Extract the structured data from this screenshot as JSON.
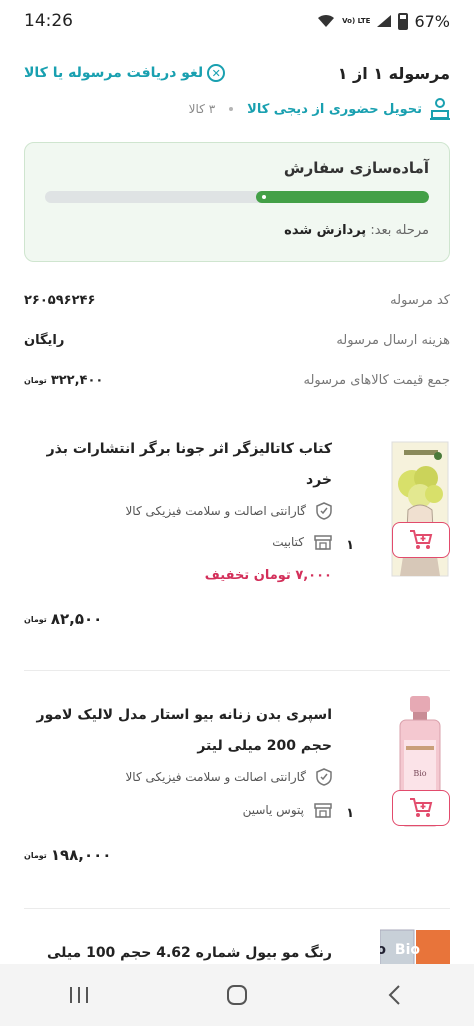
{
  "status": {
    "time": "14:26",
    "battery": "67%",
    "lte": "Vo) LTE"
  },
  "shipment": {
    "title": "مرسوله ۱ از ۱",
    "cancel_label": "لغو دریافت مرسوله یا کالا",
    "delivery_label": "تحویل حضوری از دیجی کالا",
    "items_count": "۳ کالا"
  },
  "progress": {
    "title": "آماده‌سازی سفارش",
    "fraction": 0.45,
    "next_label": "مرحله بعد:",
    "next_value": "پردازش شده"
  },
  "info": [
    {
      "key": "کد مرسوله",
      "value": "۲۶۰۵۹۶۲۴۶"
    },
    {
      "key": "هزینه ارسال مرسوله",
      "value": "رایگان"
    },
    {
      "key": "جمع قیمت کالاهای مرسوله",
      "value": "۳۲۲,۴۰۰"
    }
  ],
  "currency": "تومان",
  "products": [
    {
      "title_line1": "کتاب کاتالیزگر اثر جونا برگر انتشارات بذر",
      "title_line2": "خرد",
      "warranty": "گارانتی اصالت و سلامت فیزیکی کالا",
      "seller": "کتابیت",
      "discount": "۷,۰۰۰ تومان تخفیف",
      "price": "۸۲,۵۰۰",
      "qty": "۱"
    },
    {
      "title_line1": "اسپری بدن زنانه بیو استار مدل لالیک لامور",
      "title_line2": "حجم 200 میلی لیتر",
      "warranty": "گارانتی اصالت و سلامت فیزیکی کالا",
      "seller": "پتوس یاسین",
      "price": "۱۹۸,۰۰۰",
      "qty": "۱"
    },
    {
      "title_line1": "رنگ مو بیول شماره 4.62 حجم 100 میلی"
    }
  ],
  "colors": {
    "accent": "#19a0b0",
    "progress": "#43a047",
    "cart": "#e24b6c",
    "discount": "#d32f5a"
  },
  "icons": {
    "cancel": "close-circle-icon",
    "delivery": "person-pickup-icon",
    "warranty": "shield-check-icon",
    "seller": "store-icon",
    "cart": "add-to-cart-icon"
  }
}
